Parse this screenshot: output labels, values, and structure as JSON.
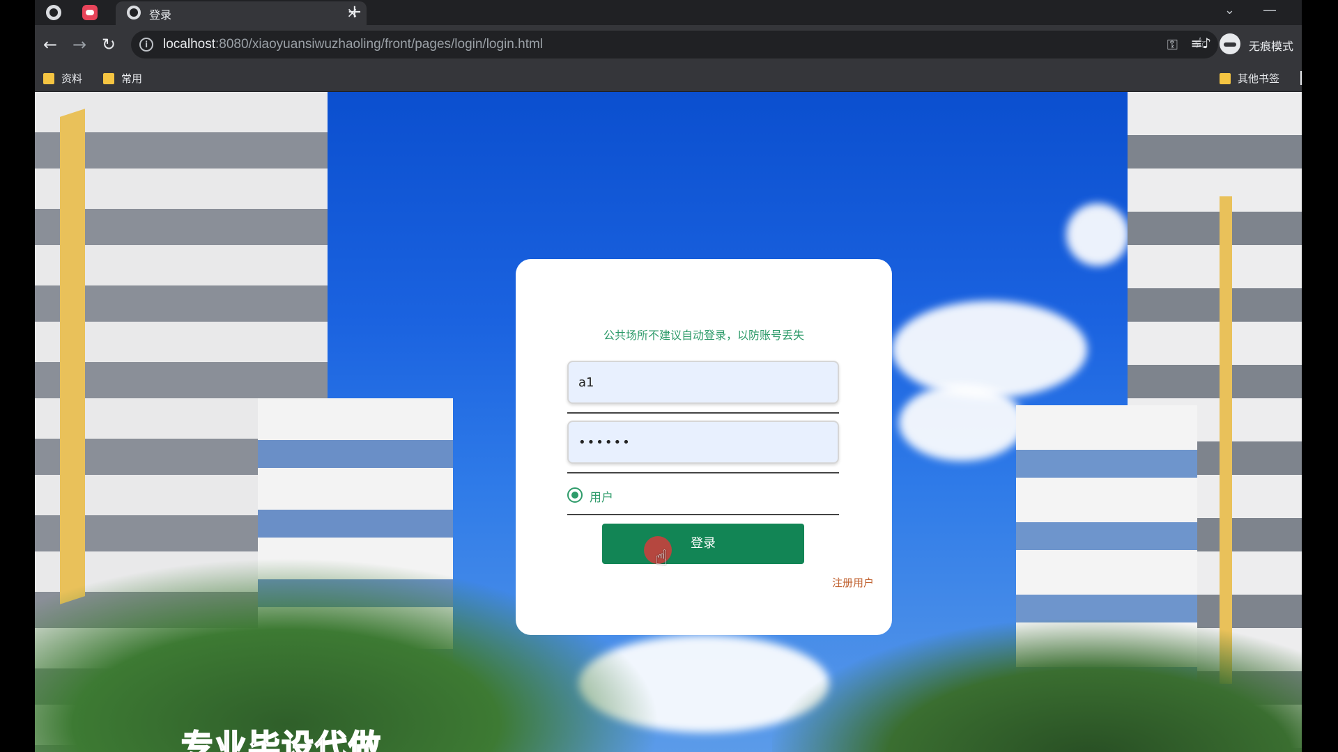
{
  "browser": {
    "tabs": [
      {
        "label": "",
        "icon": "globe-icon"
      },
      {
        "label": "",
        "icon": "bilibili-icon"
      },
      {
        "label": "登录",
        "icon": "globe-icon",
        "active": true
      }
    ],
    "close_glyph": "×",
    "new_tab_glyph": "+",
    "dropdown_glyph": "⌄",
    "minimize_glyph": "—",
    "back_glyph": "←",
    "forward_glyph": "→",
    "reload_glyph": "↻",
    "info_glyph": "i",
    "url_host": "localhost",
    "url_rest": ":8080/xiaoyuansiwuzhaoling/front/pages/login/login.html",
    "key_glyph": "⚿",
    "star_glyph": "☆",
    "media_glyph": "≡♪",
    "incognito_label": "无痕模式",
    "bookmarks": [
      "资料",
      "常用"
    ],
    "other_bookmarks": "其他书签"
  },
  "page": {
    "notice": "公共场所不建议自动登录，以防账号丢失",
    "username_value": "a1",
    "password_value": "••••••",
    "role_label": "用户",
    "login_button": "登录",
    "register_link": "注册用户",
    "bottom_overlay_text": "专业毕设代做",
    "accent_color": "#128555",
    "notice_color": "#2e9b6a"
  }
}
